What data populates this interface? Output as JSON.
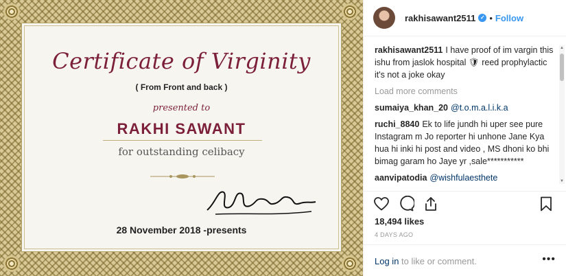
{
  "certificate": {
    "title": "Certificate of Virginity",
    "subtitle": "( From Front and back )",
    "presented": "presented to",
    "name": "RAKHI SAWANT",
    "reason": "for outstanding celibacy",
    "date": "28 November 2018 -presents"
  },
  "post": {
    "username": "rakhisawant2511",
    "follow_label": "Follow",
    "dot": "•",
    "caption": {
      "user": "rakhisawant2511",
      "text": "I have proof of im vargin this ishu from jaslok hospital 🛡 reed prophylactic it's not a joke okay"
    },
    "load_more": "Load more comments",
    "comments": [
      {
        "user": "sumaiya_khan_20",
        "mention": "@t.o.m.a.l.i.k.a",
        "text": ""
      },
      {
        "user": "ruchi_8840",
        "mention": "",
        "text": "Ek to life jundh hi uper see pure Instagram m Jo reporter hi unhone Jane Kya hua hi inki hi post and video , MS dhoni ko bhi bimag garam ho Jaye yr ,sale***********"
      },
      {
        "user": "aanvipatodia",
        "mention": "@wishfulaesthete",
        "text": ""
      }
    ],
    "likes": "18,494 likes",
    "time": "4 DAYS AGO",
    "login_link": "Log in",
    "login_rest": " to like or comment.",
    "more": "•••"
  },
  "icons": {
    "like": "heart-icon",
    "comment": "comment-icon",
    "share": "share-icon",
    "save": "bookmark-icon",
    "verified": "verified-badge-icon"
  },
  "colors": {
    "accent": "#3897f0",
    "certificate_text": "#7b1f3a",
    "border": "#d8c996"
  }
}
